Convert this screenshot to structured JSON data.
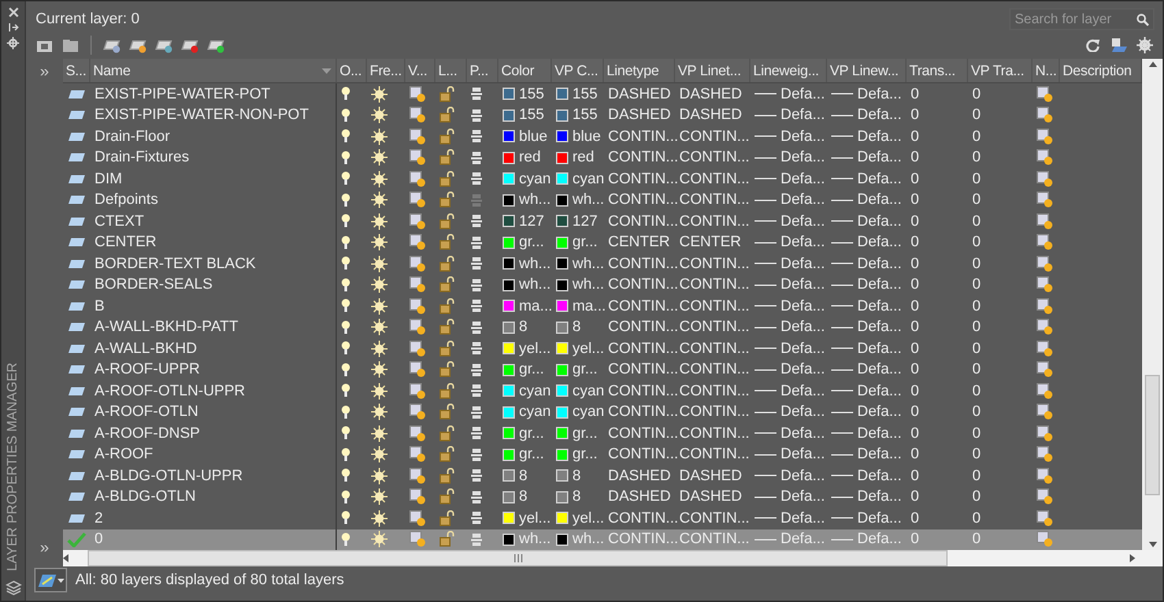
{
  "panel": {
    "title": "LAYER PROPERTIES MANAGER"
  },
  "current_layer": "Current layer: 0",
  "search": {
    "placeholder": "Search for layer"
  },
  "filter_toggles": [
    "»",
    "»"
  ],
  "columns": [
    "S...",
    "Name",
    "O...",
    "Fre...",
    "V...",
    "L...",
    "P...",
    "Color",
    "VP C...",
    "Linetype",
    "VP Linet...",
    "Lineweig...",
    "VP Linew...",
    "Trans...",
    "VP Tra...",
    "N...",
    "Description"
  ],
  "rows": [
    {
      "name": "EXIST-PIPE-WATER-POT",
      "current": false,
      "selected": false,
      "plot": true,
      "color": "#3d6b8e",
      "color_name": "155",
      "vp_color_name": "155",
      "linetype": "DASHED",
      "vp_linetype": "DASHED",
      "lineweight": "Defa...",
      "vp_lineweight": "Defa...",
      "transparency": "0",
      "vp_transparency": "0"
    },
    {
      "name": "EXIST-PIPE-WATER-NON-POT",
      "current": false,
      "selected": false,
      "plot": true,
      "color": "#3d6b8e",
      "color_name": "155",
      "vp_color_name": "155",
      "linetype": "DASHED",
      "vp_linetype": "DASHED",
      "lineweight": "Defa...",
      "vp_lineweight": "Defa...",
      "transparency": "0",
      "vp_transparency": "0"
    },
    {
      "name": "Drain-Floor",
      "current": false,
      "selected": false,
      "plot": true,
      "color": "#0000ff",
      "color_name": "blue",
      "vp_color_name": "blue",
      "linetype": "CONTIN...",
      "vp_linetype": "CONTIN...",
      "lineweight": "Defa...",
      "vp_lineweight": "Defa...",
      "transparency": "0",
      "vp_transparency": "0"
    },
    {
      "name": "Drain-Fixtures",
      "current": false,
      "selected": false,
      "plot": true,
      "color": "#ff0000",
      "color_name": "red",
      "vp_color_name": "red",
      "linetype": "CONTIN...",
      "vp_linetype": "CONTIN...",
      "lineweight": "Defa...",
      "vp_lineweight": "Defa...",
      "transparency": "0",
      "vp_transparency": "0"
    },
    {
      "name": "DIM",
      "current": false,
      "selected": false,
      "plot": true,
      "color": "#00ffff",
      "color_name": "cyan",
      "vp_color_name": "cyan",
      "linetype": "CONTIN...",
      "vp_linetype": "CONTIN...",
      "lineweight": "Defa...",
      "vp_lineweight": "Defa...",
      "transparency": "0",
      "vp_transparency": "0"
    },
    {
      "name": "Defpoints",
      "current": false,
      "selected": false,
      "plot": false,
      "color": "#000000",
      "color_name": "wh...",
      "vp_color_name": "wh...",
      "linetype": "CONTIN...",
      "vp_linetype": "CONTIN...",
      "lineweight": "Defa...",
      "vp_lineweight": "Defa...",
      "transparency": "0",
      "vp_transparency": "0"
    },
    {
      "name": "CTEXT",
      "current": false,
      "selected": false,
      "plot": true,
      "color": "#1f4d40",
      "color_name": "127",
      "vp_color_name": "127",
      "linetype": "CONTIN...",
      "vp_linetype": "CONTIN...",
      "lineweight": "Defa...",
      "vp_lineweight": "Defa...",
      "transparency": "0",
      "vp_transparency": "0"
    },
    {
      "name": "CENTER",
      "current": false,
      "selected": false,
      "plot": true,
      "color": "#00ff00",
      "color_name": "gr...",
      "vp_color_name": "gr...",
      "linetype": "CENTER",
      "vp_linetype": "CENTER",
      "lineweight": "Defa...",
      "vp_lineweight": "Defa...",
      "transparency": "0",
      "vp_transparency": "0"
    },
    {
      "name": "BORDER-TEXT BLACK",
      "current": false,
      "selected": false,
      "plot": true,
      "color": "#000000",
      "color_name": "wh...",
      "vp_color_name": "wh...",
      "linetype": "CONTIN...",
      "vp_linetype": "CONTIN...",
      "lineweight": "Defa...",
      "vp_lineweight": "Defa...",
      "transparency": "0",
      "vp_transparency": "0"
    },
    {
      "name": "BORDER-SEALS",
      "current": false,
      "selected": false,
      "plot": true,
      "color": "#000000",
      "color_name": "wh...",
      "vp_color_name": "wh...",
      "linetype": "CONTIN...",
      "vp_linetype": "CONTIN...",
      "lineweight": "Defa...",
      "vp_lineweight": "Defa...",
      "transparency": "0",
      "vp_transparency": "0"
    },
    {
      "name": "B",
      "current": false,
      "selected": false,
      "plot": true,
      "color": "#ff00ff",
      "color_name": "ma...",
      "vp_color_name": "ma...",
      "linetype": "CONTIN...",
      "vp_linetype": "CONTIN...",
      "lineweight": "Defa...",
      "vp_lineweight": "Defa...",
      "transparency": "0",
      "vp_transparency": "0"
    },
    {
      "name": "A-WALL-BKHD-PATT",
      "current": false,
      "selected": false,
      "plot": true,
      "color": "#808080",
      "color_name": "8",
      "vp_color_name": "8",
      "linetype": "CONTIN...",
      "vp_linetype": "CONTIN...",
      "lineweight": "Defa...",
      "vp_lineweight": "Defa...",
      "transparency": "0",
      "vp_transparency": "0"
    },
    {
      "name": "A-WALL-BKHD",
      "current": false,
      "selected": false,
      "plot": true,
      "color": "#ffff00",
      "color_name": "yel...",
      "vp_color_name": "yel...",
      "linetype": "CONTIN...",
      "vp_linetype": "CONTIN...",
      "lineweight": "Defa...",
      "vp_lineweight": "Defa...",
      "transparency": "0",
      "vp_transparency": "0"
    },
    {
      "name": "A-ROOF-UPPR",
      "current": false,
      "selected": false,
      "plot": true,
      "color": "#00ff00",
      "color_name": "gr...",
      "vp_color_name": "gr...",
      "linetype": "CONTIN...",
      "vp_linetype": "CONTIN...",
      "lineweight": "Defa...",
      "vp_lineweight": "Defa...",
      "transparency": "0",
      "vp_transparency": "0"
    },
    {
      "name": "A-ROOF-OTLN-UPPR",
      "current": false,
      "selected": false,
      "plot": true,
      "color": "#00ffff",
      "color_name": "cyan",
      "vp_color_name": "cyan",
      "linetype": "CONTIN...",
      "vp_linetype": "CONTIN...",
      "lineweight": "Defa...",
      "vp_lineweight": "Defa...",
      "transparency": "0",
      "vp_transparency": "0"
    },
    {
      "name": "A-ROOF-OTLN",
      "current": false,
      "selected": false,
      "plot": true,
      "color": "#00ffff",
      "color_name": "cyan",
      "vp_color_name": "cyan",
      "linetype": "CONTIN...",
      "vp_linetype": "CONTIN...",
      "lineweight": "Defa...",
      "vp_lineweight": "Defa...",
      "transparency": "0",
      "vp_transparency": "0"
    },
    {
      "name": "A-ROOF-DNSP",
      "current": false,
      "selected": false,
      "plot": true,
      "color": "#00ff00",
      "color_name": "gr...",
      "vp_color_name": "gr...",
      "linetype": "CONTIN...",
      "vp_linetype": "CONTIN...",
      "lineweight": "Defa...",
      "vp_lineweight": "Defa...",
      "transparency": "0",
      "vp_transparency": "0"
    },
    {
      "name": "A-ROOF",
      "current": false,
      "selected": false,
      "plot": true,
      "color": "#00ff00",
      "color_name": "gr...",
      "vp_color_name": "gr...",
      "linetype": "CONTIN...",
      "vp_linetype": "CONTIN...",
      "lineweight": "Defa...",
      "vp_lineweight": "Defa...",
      "transparency": "0",
      "vp_transparency": "0"
    },
    {
      "name": "A-BLDG-OTLN-UPPR",
      "current": false,
      "selected": false,
      "plot": true,
      "color": "#808080",
      "color_name": "8",
      "vp_color_name": "8",
      "linetype": "DASHED",
      "vp_linetype": "DASHED",
      "lineweight": "Defa...",
      "vp_lineweight": "Defa...",
      "transparency": "0",
      "vp_transparency": "0"
    },
    {
      "name": "A-BLDG-OTLN",
      "current": false,
      "selected": false,
      "plot": true,
      "color": "#808080",
      "color_name": "8",
      "vp_color_name": "8",
      "linetype": "DASHED",
      "vp_linetype": "DASHED",
      "lineweight": "Defa...",
      "vp_lineweight": "Defa...",
      "transparency": "0",
      "vp_transparency": "0"
    },
    {
      "name": "2",
      "current": false,
      "selected": false,
      "plot": true,
      "color": "#ffff00",
      "color_name": "yel...",
      "vp_color_name": "yel...",
      "linetype": "CONTIN...",
      "vp_linetype": "CONTIN...",
      "lineweight": "Defa...",
      "vp_lineweight": "Defa...",
      "transparency": "0",
      "vp_transparency": "0"
    },
    {
      "name": "0",
      "current": true,
      "selected": true,
      "plot": true,
      "color": "#000000",
      "color_name": "wh...",
      "vp_color_name": "wh...",
      "linetype": "CONTIN...",
      "vp_linetype": "CONTIN...",
      "lineweight": "Defa...",
      "vp_lineweight": "Defa...",
      "transparency": "0",
      "vp_transparency": "0"
    }
  ],
  "status": "All: 80 layers displayed of 80 total layers"
}
